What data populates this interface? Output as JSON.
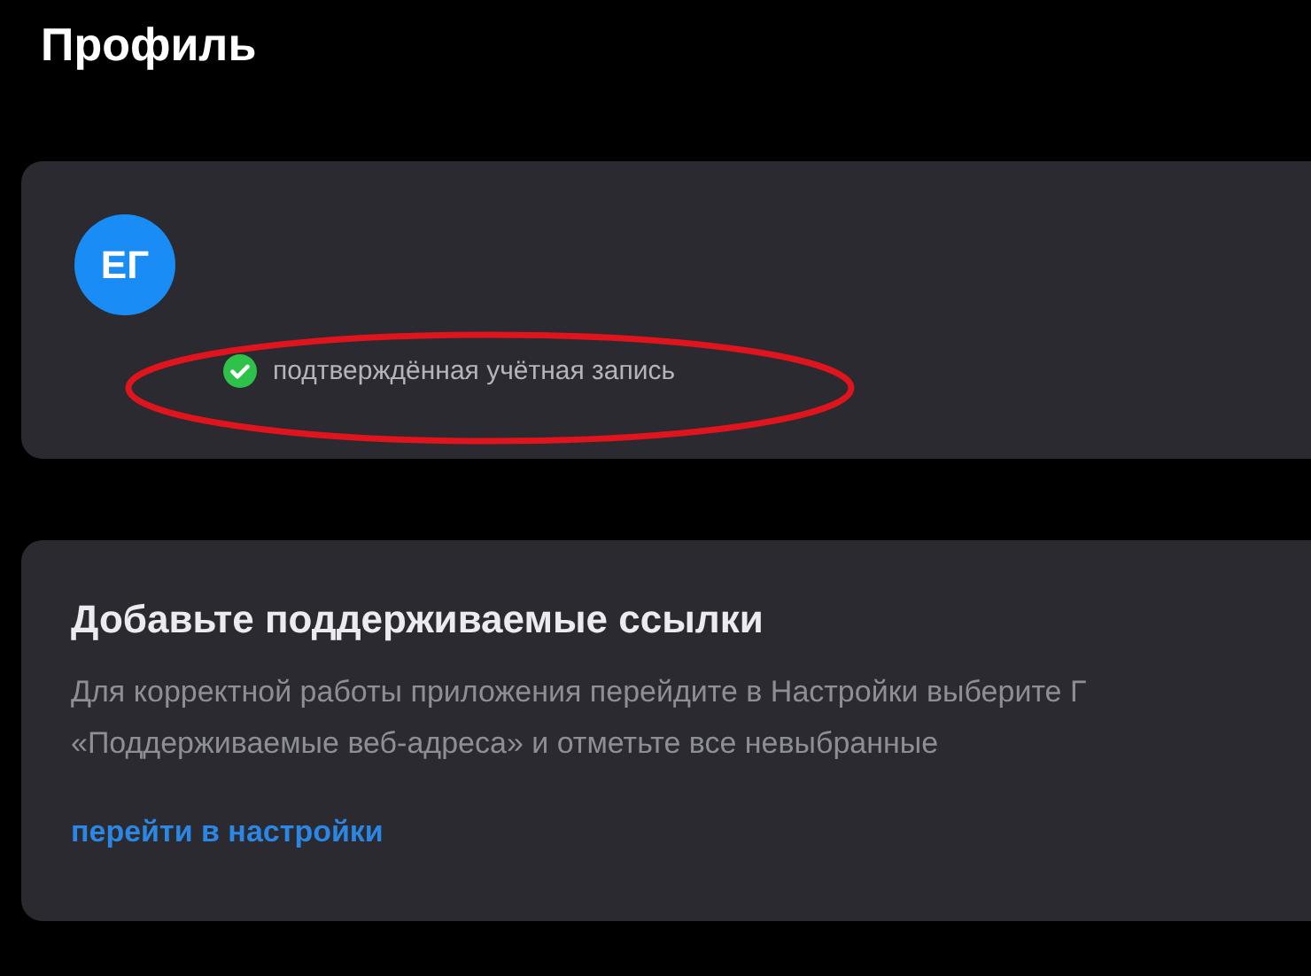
{
  "title": "Профиль",
  "profile": {
    "initials": "ЕГ",
    "verified": true,
    "status": "подтверждённая учётная запись",
    "highlighted": true
  },
  "notice": {
    "heading": "Добавьте поддерживаемые ссылки",
    "lines": [
      "Для корректной работы приложения перейдите в Настройки выберите Г",
      "«Поддерживаемые веб-адреса» и отметьте все невыбранные"
    ],
    "link": "перейти в настройки"
  }
}
